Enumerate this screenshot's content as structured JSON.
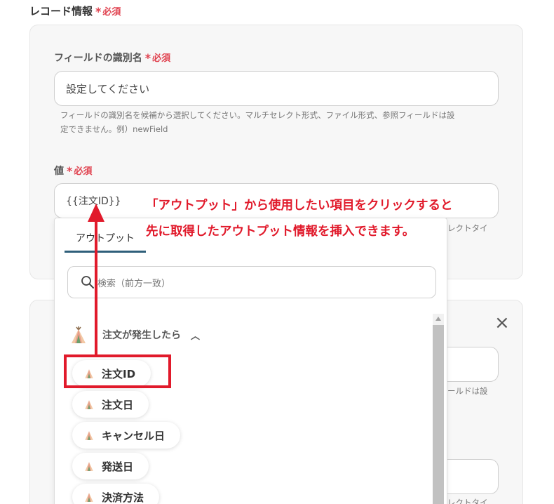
{
  "record_section": {
    "label": "レコード情報",
    "required": "必須"
  },
  "field1": {
    "label": "フィールドの識別名",
    "required": "必須",
    "placeholder": "設定してください",
    "hint_line1": "フィールドの識別名を候補から選択してください。マルチセレクト形式、ファイル形式、参照フィールドは設",
    "hint_line2": "定できません。例）newField"
  },
  "value_field": {
    "label": "値",
    "required": "必須",
    "value": "{{注文ID}}",
    "hint_partial": "レクトタイ"
  },
  "card2": {
    "hint_partial1": "ールドは設",
    "hint_partial2": "レクトタイ"
  },
  "dropdown": {
    "tab_label": "アウトプット",
    "search_placeholder": "検索（前方一致）",
    "group_label": "注文が発生したら",
    "items": [
      {
        "label": "注文ID"
      },
      {
        "label": "注文日"
      },
      {
        "label": "キャンセル日"
      },
      {
        "label": "発送日"
      },
      {
        "label": "決済方法"
      }
    ]
  },
  "annotation": {
    "line1": "「アウトプット」から使用したい項目をクリックすると",
    "line2": "先に取得したアウトプット情報を挿入できます。"
  },
  "colors": {
    "required": "#e0424f",
    "annotation": "#e11a2b",
    "tab_underline": "#2f5f7a"
  }
}
